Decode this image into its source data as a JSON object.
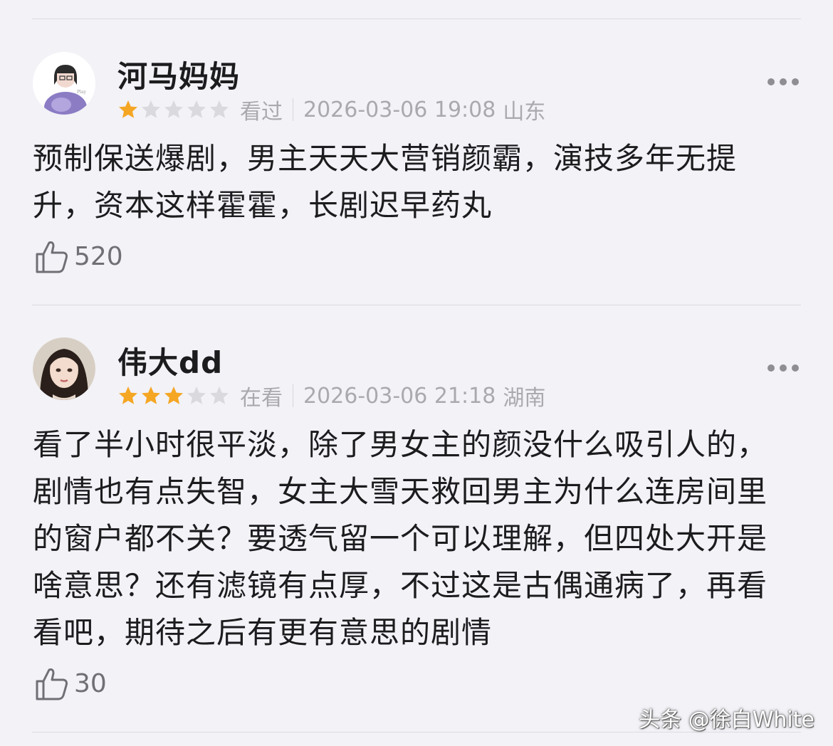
{
  "reviews": [
    {
      "username": "河马妈妈",
      "rating": 1,
      "status": "看过",
      "datetime": "2026-03-06 19:08",
      "location": "山东",
      "content_lines": [
        "预制保送爆剧，男主天天大营销颜霸，演技多年无提",
        "升，资本这样霍霍，长剧迟早药丸"
      ],
      "likes": "520",
      "avatar_icon": "avatar-girl-purple-sweater-icon"
    },
    {
      "username": "伟大dd",
      "rating": 3,
      "status": "在看",
      "datetime": "2026-03-06 21:18",
      "location": "湖南",
      "content_lines": [
        "看了半小时很平淡，除了男女主的颜没什么吸引人的，",
        "剧情也有点失智，女主大雪天救回男主为什么连房间里",
        "的窗户都不关？要透气留一个可以理解，但四处大开是",
        "啥意思？还有滤镜有点厚，不过这是古偶通病了，再看",
        "看吧，期待之后有更有意思的剧情"
      ],
      "likes": "30",
      "avatar_icon": "avatar-girl-portrait-icon"
    }
  ],
  "max_rating": 5,
  "icons": {
    "more": "more-dots-icon",
    "like": "thumbs-up-icon",
    "star": "star-icon"
  },
  "colors": {
    "star_filled": "#f5a623",
    "star_empty": "#d9d9de",
    "meta_text": "#a9a9ae",
    "background": "#f2f2f7"
  },
  "watermark": "头条 @徐白White"
}
